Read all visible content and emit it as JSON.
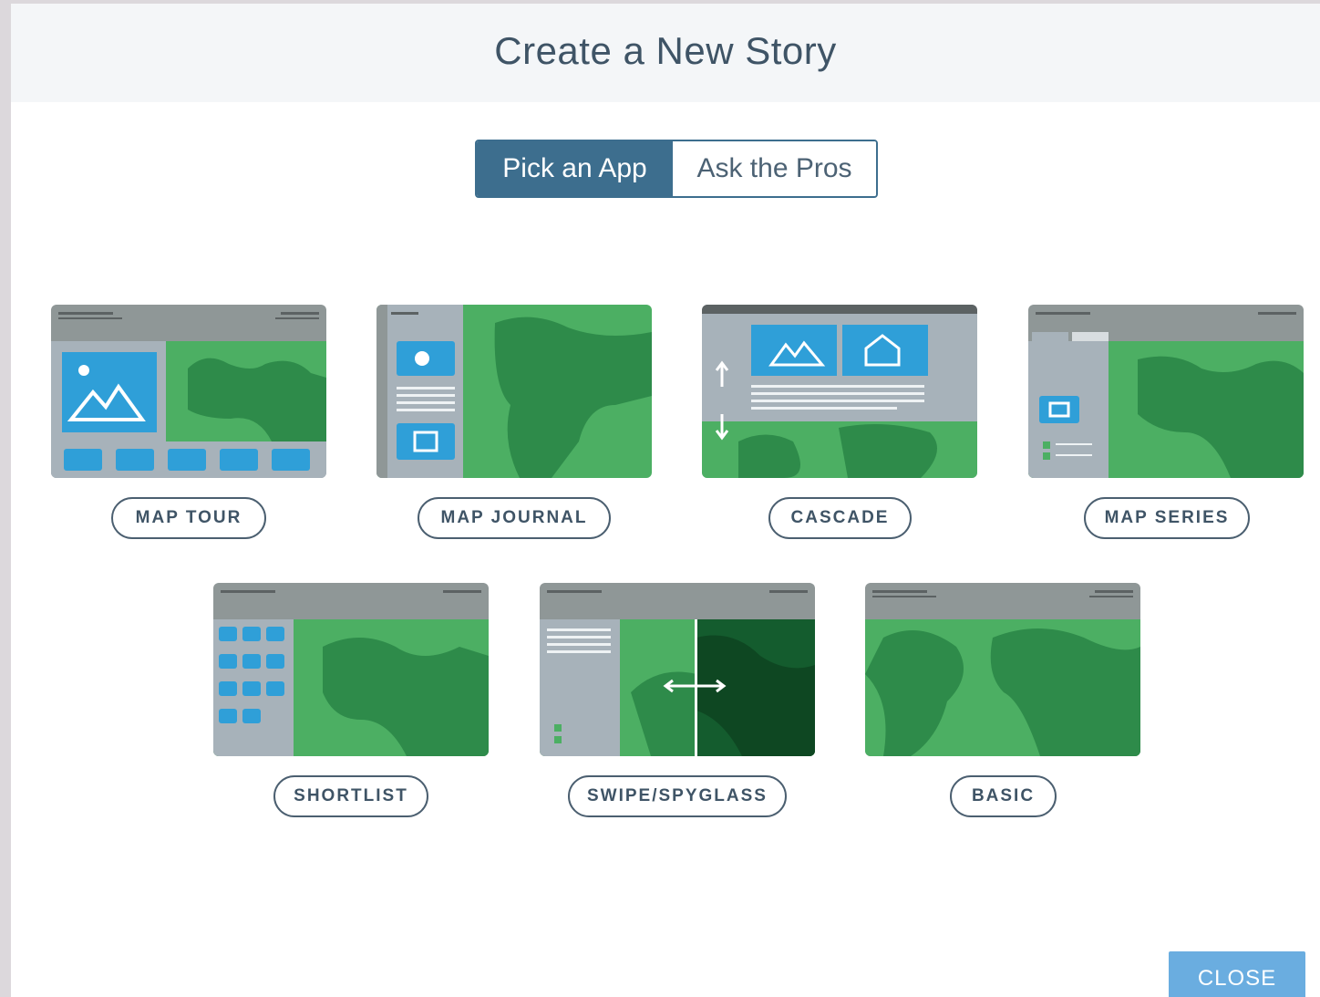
{
  "dialog": {
    "title": "Create a New Story",
    "tabs": [
      {
        "label": "Pick an App",
        "selected": true
      },
      {
        "label": "Ask the Pros",
        "selected": false
      }
    ],
    "close_label": "CLOSE"
  },
  "apps": [
    {
      "label": "MAP TOUR",
      "thumbnail": "map-tour-thumbnail"
    },
    {
      "label": "MAP JOURNAL",
      "thumbnail": "map-journal-thumbnail"
    },
    {
      "label": "CASCADE",
      "thumbnail": "cascade-thumbnail"
    },
    {
      "label": "MAP SERIES",
      "thumbnail": "map-series-thumbnail"
    },
    {
      "label": "SHORTLIST",
      "thumbnail": "shortlist-thumbnail"
    },
    {
      "label": "SWIPE/SPYGLASS",
      "thumbnail": "swipe-spyglass-thumbnail"
    },
    {
      "label": "BASIC",
      "thumbnail": "basic-thumbnail"
    }
  ],
  "colors": {
    "accent": "#3d6e8e",
    "close_button": "#6aade0",
    "map_green": "#4caf63",
    "land_dark": "#2e8b4a",
    "panel_gray": "#a7b2ba",
    "header_gray": "#979d9c",
    "photo_blue": "#2f9fd8"
  }
}
